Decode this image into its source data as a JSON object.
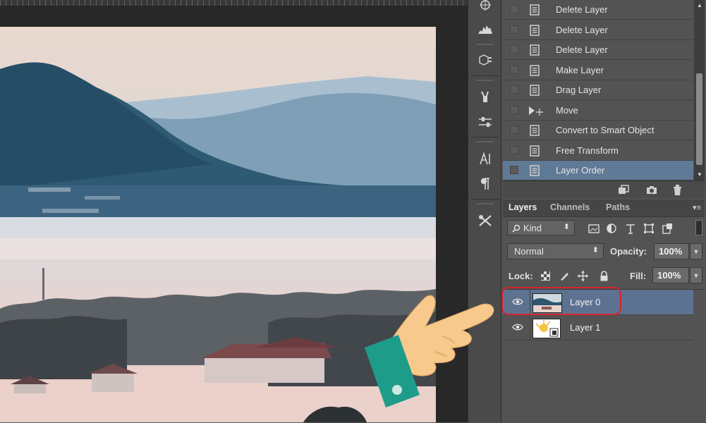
{
  "history": {
    "items": [
      {
        "label": "Delete Layer",
        "icon": "document-icon",
        "active": false
      },
      {
        "label": "Delete Layer",
        "icon": "document-icon",
        "active": false
      },
      {
        "label": "Delete Layer",
        "icon": "document-icon",
        "active": false
      },
      {
        "label": "Make Layer",
        "icon": "document-icon",
        "active": false
      },
      {
        "label": "Drag Layer",
        "icon": "document-icon",
        "active": false
      },
      {
        "label": "Move",
        "icon": "move-tool-icon",
        "active": false
      },
      {
        "label": "Convert to Smart Object",
        "icon": "document-icon",
        "active": false
      },
      {
        "label": "Free Transform",
        "icon": "document-icon",
        "active": false
      },
      {
        "label": "Layer Order",
        "icon": "document-icon",
        "active": true
      }
    ]
  },
  "layers_panel": {
    "tabs": [
      {
        "label": "Layers",
        "active": true
      },
      {
        "label": "Channels",
        "active": false
      },
      {
        "label": "Paths",
        "active": false
      }
    ],
    "filter": {
      "kind_label": "Kind",
      "arrows": "⬍"
    },
    "blend_mode": "Normal",
    "opacity_label": "Opacity:",
    "opacity_value": "100%",
    "lock_label": "Lock:",
    "fill_label": "Fill:",
    "fill_value": "100%",
    "layers": [
      {
        "name": "Layer 0",
        "selected": true,
        "thumbnail": "landscape-thumbnail"
      },
      {
        "name": "Layer 1",
        "selected": false,
        "thumbnail": "smart-object-thumbnail"
      }
    ]
  },
  "colors": {
    "panel_bg": "#535353",
    "selection": "#5d7290",
    "highlight_ring": "#d8232a",
    "hand_skin": "#f7c98c",
    "hand_cuff": "#1e9c8a"
  }
}
